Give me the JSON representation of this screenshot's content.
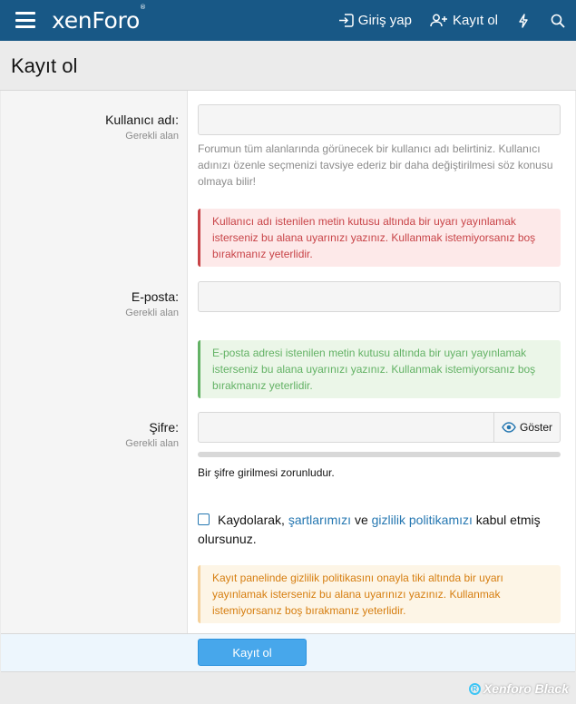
{
  "header": {
    "logo": "xenForo",
    "logo_mark": "®",
    "login_label": "Giriş yap",
    "register_label": "Kayıt ol",
    "icons": [
      "menu-icon",
      "login-icon",
      "register-icon",
      "whats-new-icon",
      "search-icon"
    ]
  },
  "page": {
    "title": "Kayıt ol"
  },
  "form": {
    "username": {
      "label": "Kullanıcı adı:",
      "required": "Gerekli alan",
      "value": "",
      "explain": "Forumun tüm alanlarında görünecek bir kullanıcı adı belirtiniz. Kullanıcı adınızı özenle seçmenizi tavsiye ederiz bir daha değiştirilmesi söz konusu olmaya bilir!",
      "notice": "Kullanıcı adı istenilen metin kutusu altında bir uyarı yayınlamak isterseniz bu alana uyarınızı yazınız. Kullanmak istemiyorsanız boş bırakmanız yeterlidir."
    },
    "email": {
      "label": "E-posta:",
      "required": "Gerekli alan",
      "value": "",
      "notice": "E-posta adresi istenilen metin kutusu altında bir uyarı yayınlamak isterseniz bu alana uyarınızı yazınız. Kullanmak istemiyorsanız boş bırakmanız yeterlidir."
    },
    "password": {
      "label": "Şifre:",
      "required": "Gerekli alan",
      "value": "",
      "toggle_label": "Göster",
      "strength_text": "Bir şifre girilmesi zorunludur.",
      "strength_fill": 1.0
    },
    "agree": {
      "checked": false,
      "prefix": "Kaydolarak,",
      "terms_link": "şartlarımızı",
      "middle": "ve",
      "privacy_link": "gizlilik politikamızı",
      "suffix": "kabul etmiş olursunuz.",
      "notice": "Kayıt panelinde gizlilik politikasını onayla tiki altında bir uyarı yayınlamak isterseniz bu alana uyarınızı yazınız. Kullanmak istemiyorsanız boş bırakmanız yeterlidir."
    },
    "submit_label": "Kayıt ol"
  },
  "watermark": {
    "text": "Xenforo Black"
  },
  "colors": {
    "header_bg": "#185886",
    "link": "#2577b1",
    "button": "#47a7eb",
    "error": "#c84448",
    "success": "#63b265",
    "warning": "#d67e10"
  }
}
